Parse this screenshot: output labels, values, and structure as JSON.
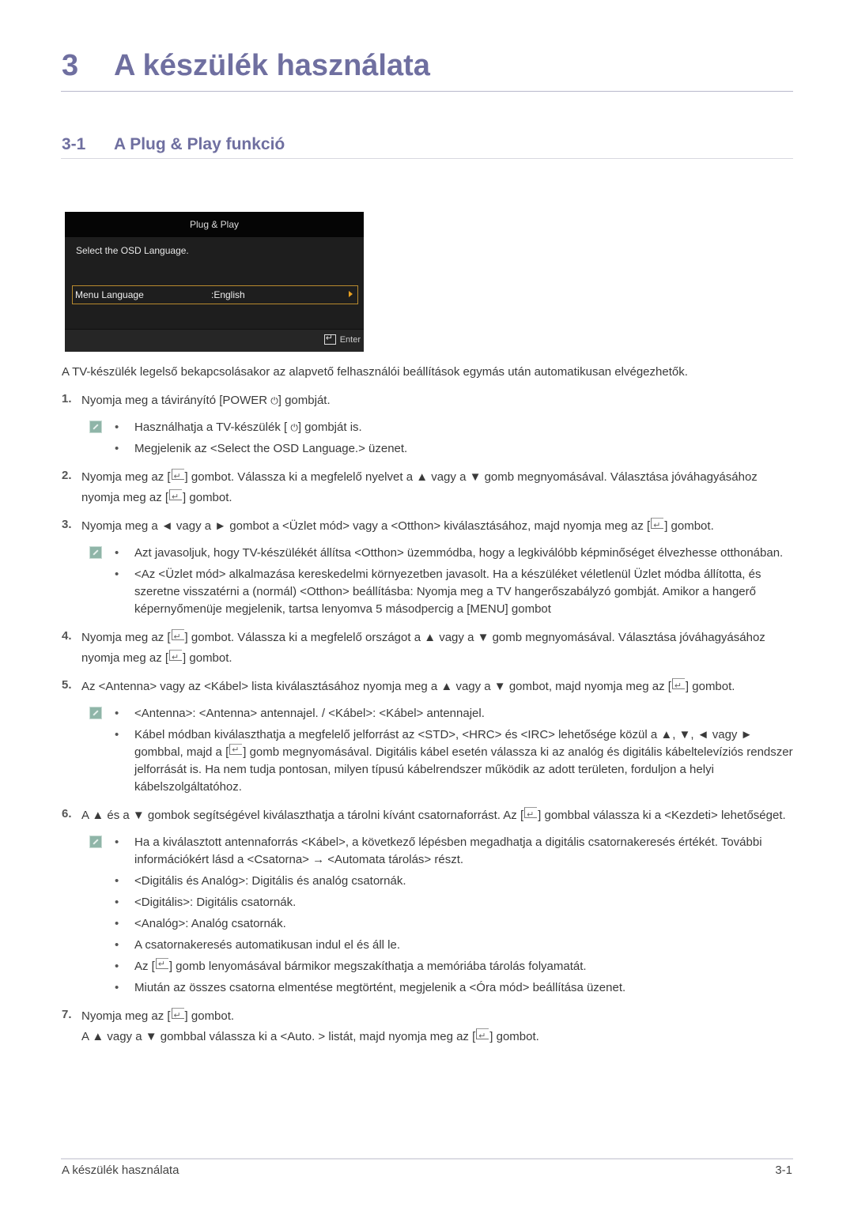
{
  "chapter": {
    "number": "3",
    "title": "A készülék használata"
  },
  "section": {
    "number": "3-1",
    "title": "A Plug & Play funkció"
  },
  "osd": {
    "header": "Plug & Play",
    "message": "Select the OSD Language.",
    "row_label": "Menu Language",
    "row_value": ":English",
    "footer_label": "Enter",
    "colors": {
      "highlight_border": "#b88a2e",
      "arrow": "#e8a020"
    }
  },
  "intro": "A TV-készülék legelső bekapcsolásakor az alapvető felhasználói beállítások egymás után automatikusan elvégezhetők.",
  "steps": [
    {
      "num": "1.",
      "parts": [
        "Nyomja meg a távirányító [POWER ",
        "] gombját."
      ],
      "notes": [
        [
          "Használhatja a TV-készülék [ ",
          "] gombját is."
        ],
        "Megjelenik az <Select the OSD Language.> üzenet."
      ]
    },
    {
      "num": "2.",
      "parts": [
        "Nyomja meg az [",
        "] gombot. Válassza ki a megfelelő nyelvet a ▲ vagy a ▼ gomb megnyomásával. Választása jóváhagyásához nyomja meg az [",
        "] gombot."
      ]
    },
    {
      "num": "3.",
      "parts": [
        "Nyomja meg a ◄ vagy a ► gombot a <Üzlet mód> vagy a <Otthon> kiválasztásához, majd nyomja meg az [",
        "] gombot."
      ],
      "notes": [
        "Azt javasoljuk, hogy TV-készülékét állítsa <Otthon> üzemmódba, hogy a legkiválóbb képminőséget élvezhesse otthonában.",
        "<Az <Üzlet mód> alkalmazása kereskedelmi környezetben javasolt. Ha a készüléket véletlenül Üzlet módba állította, és szeretne visszatérni a (normál) <Otthon> beállításba: Nyomja meg a TV hangerőszabályzó gombját. Amikor a hangerő képernyőmenüje megjelenik, tartsa lenyomva 5 másodpercig a [MENU] gombot"
      ]
    },
    {
      "num": "4.",
      "parts": [
        "Nyomja meg az [",
        "] gombot. Válassza ki a megfelelő országot a ▲ vagy a ▼ gomb megnyomásával. Választása jóváhagyásához nyomja meg az [",
        "] gombot."
      ]
    },
    {
      "num": "5.",
      "parts": [
        "Az <Antenna> vagy az <Kábel> lista kiválasztásához nyomja meg a ▲ vagy a ▼ gombot, majd nyomja meg az [",
        "] gombot."
      ],
      "notes": [
        "<Antenna>: <Antenna> antennajel. / <Kábel>: <Kábel> antennajel.",
        [
          "Kábel módban kiválaszthatja a megfelelő jelforrást az <STD>, <HRC> és <IRC> lehetősége közül a ▲, ▼, ◄ vagy ► gombbal, majd a [",
          "] gomb megnyomásával. Digitális kábel esetén válassza ki az analóg és digitális kábeltelevíziós rendszer jelforrását is. Ha nem tudja pontosan, milyen típusú kábelrendszer működik az adott területen, forduljon a helyi kábelszolgáltatóhoz."
        ]
      ]
    },
    {
      "num": "6.",
      "parts": [
        "A ▲ és a ▼ gombok segítségével kiválaszthatja a tárolni kívánt csatornaforrást. Az [",
        "] gombbal válassza ki a <Kezdeti> lehetőséget."
      ],
      "notes": [
        "Ha a kiválasztott antennaforrás <Kábel>, a következő lépésben megadhatja a digitális csatornakeresés értékét. További információkért lásd a <Csatorna> → <Automata tárolás> részt.",
        "<Digitális és Analóg>: Digitális és analóg csatornák.",
        "<Digitális>: Digitális csatornák.",
        "<Analóg>: Analóg csatornák.",
        "A csatornakeresés automatikusan indul el és áll le.",
        [
          "Az [",
          "] gomb lenyomásával bármikor megszakíthatja a memóriába tárolás folyamatát."
        ],
        "Miután az összes csatorna elmentése megtörtént, megjelenik a <Óra mód> beállítása üzenet."
      ]
    },
    {
      "num": "7.",
      "parts": [
        "Nyomja meg az [",
        "] gombot."
      ],
      "extra": [
        "A ▲ vagy a ▼ gombbal válassza ki a <Auto. > listát, majd nyomja meg az [",
        "] gombot."
      ]
    }
  ],
  "footer": {
    "left": "A készülék használata",
    "right": "3-1"
  },
  "icons": {
    "enter": "enter-icon",
    "power": "power-icon",
    "note": "note-pencil-icon"
  },
  "colors": {
    "heading": "#6f6fa0",
    "body_text": "#3a3a3a",
    "note_icon": "#8fb5a8"
  }
}
